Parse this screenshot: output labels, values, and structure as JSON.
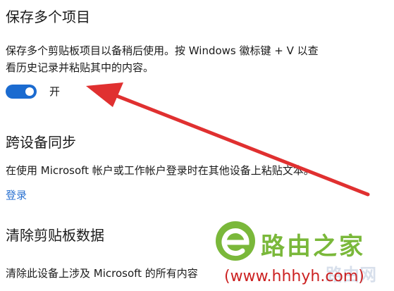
{
  "section1": {
    "title": "保存多个项目",
    "desc_line1": "保存多个剪贴板项目以备稍后使用。按 Windows 徽标键 + V 以查",
    "desc_line2": "看历史记录并粘贴其中的内容。",
    "toggle_label": "开",
    "toggle_on": true
  },
  "section2": {
    "title": "跨设备同步",
    "desc": "在使用 Microsoft 帐户或工作帐户登录时在其他设备上粘贴文本。",
    "link_label": "登录"
  },
  "section3": {
    "title": "清除剪贴板数据",
    "desc": "清除此设备上涉及 Microsoft 的所有内容"
  },
  "watermark": {
    "site_name": "路由之家",
    "url": "(www.hhhyh.com)",
    "ghost_text": "路由网"
  },
  "colors": {
    "accent": "#1b6bd0",
    "arrow": "#e03030",
    "link": "#2b72d1"
  }
}
